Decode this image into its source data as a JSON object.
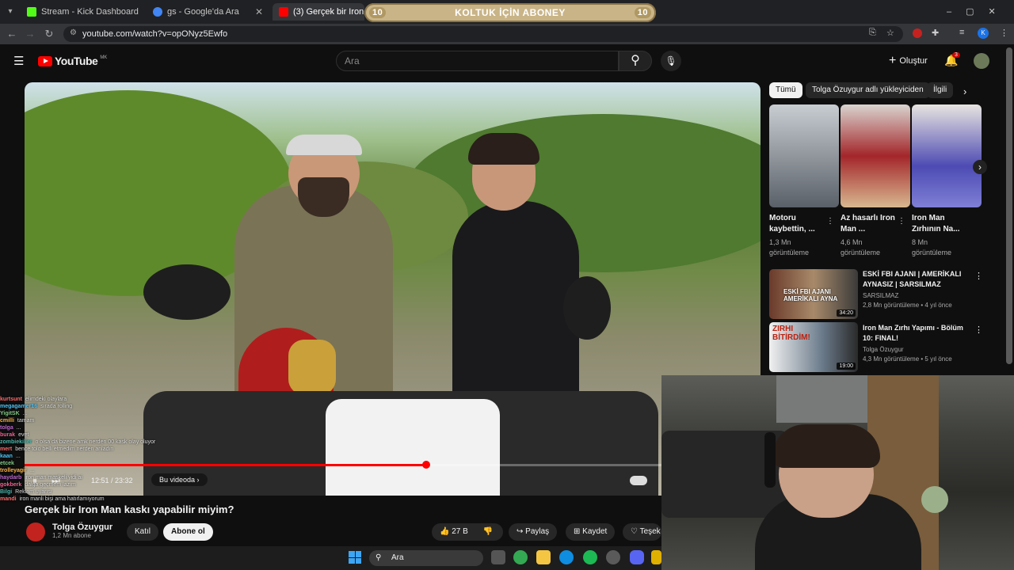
{
  "browser": {
    "tabs": [
      {
        "title": "Stream - Kick Dashboard",
        "close": "✕",
        "color": "#53fc18"
      },
      {
        "title": "gs - Google'da Ara",
        "close": "✕",
        "color": "#4285f4"
      },
      {
        "title": "(3) Gerçek bir Iron Man ka...",
        "close": "✕",
        "color": "#ff0000"
      }
    ],
    "url": "youtube.com/watch?v=opONyz5Ewfo"
  },
  "overlay": {
    "banner_text": "KOLTUK İÇİN ABONEY",
    "left_num": "10",
    "right_num": "10"
  },
  "youtube": {
    "logo": "YouTube",
    "country": "MK",
    "search_placeholder": "Ara",
    "create_label": "Oluştur",
    "notif_count": "3"
  },
  "video": {
    "time": "12:51 / 23:32",
    "chapter": "Bu videoda",
    "progress": 0.546,
    "title": "Gerçek bir Iron Man kaskı yapabilir miyim?",
    "channel": "Tolga Özuygur",
    "subs": "1,2 Mn abone",
    "join": "Katıl",
    "subscribe": "Abone ol",
    "likes": "27 B",
    "share": "Paylaş",
    "save": "Kaydet",
    "thanks": "Teşek"
  },
  "sidebar": {
    "chips": [
      "Tümü",
      "Tolga Özuygur adlı yükleyiciden",
      "İlgili"
    ],
    "shorts": [
      {
        "title": "Motoru kaybettin, ...",
        "views": "1,3 Mn",
        "views2": "görüntüleme"
      },
      {
        "title": "Az hasarlı Iron Man ...",
        "views": "4,6 Mn",
        "views2": "görüntüleme"
      },
      {
        "title": "Iron Man Zırhının Na...",
        "views": "8 Mn",
        "views2": "görüntüleme"
      }
    ],
    "related": [
      {
        "title": "ESKİ FBI AJANI | AMERİKALI AYNASIZ | SARSILMAZ",
        "channel": "SARSILMAZ",
        "meta": "2,8 Mn görüntüleme • 4 yıl önce",
        "duration": "34:20",
        "thumb_text": "ESKİ FBI AJANI AMERİKALI AYNA"
      },
      {
        "title": "Iron Man Zırhı Yapımı - Bölüm 10: FINAL!",
        "channel": "Tolga Özuygur",
        "meta": "4,3 Mn görüntüleme • 5 yıl önce",
        "duration": "19:00",
        "thumb_text": "ZIRHI BİTİRDİM!"
      }
    ]
  },
  "chat": [
    {
      "user": "kurtsunt",
      "msg": "elimdeki olaylara"
    },
    {
      "user": "megagamer16",
      "msg": "sırada rolling"
    },
    {
      "user": "YigitSK",
      "msg": "..."
    },
    {
      "user": "cmilli",
      "msg": "tamam"
    },
    {
      "user": "tolga",
      "msg": "..."
    },
    {
      "user": "burak",
      "msg": "evet"
    },
    {
      "user": "zombiekiller",
      "msg": "o olsa da bizene amk nerden 00 kask olay oluyor"
    },
    {
      "user": "mert",
      "msg": "bence tolo belli etmedim nerden anladın"
    },
    {
      "user": "kaan",
      "msg": "..."
    },
    {
      "user": "etcek",
      "msg": ""
    },
    {
      "user": "trolleyagir",
      "msg": "..."
    },
    {
      "user": "haydarb",
      "msg": "iron man maskeli yidi ai"
    },
    {
      "user": "gokberk",
      "msg": "dalga geçmem lazım"
    },
    {
      "user": "Bilgi",
      "msg": "Reklam uyarısı"
    },
    {
      "user": "mandi",
      "msg": "iron manli bişi ama hatırlamıyorum"
    }
  ],
  "taskbar": {
    "search": "Ara"
  }
}
